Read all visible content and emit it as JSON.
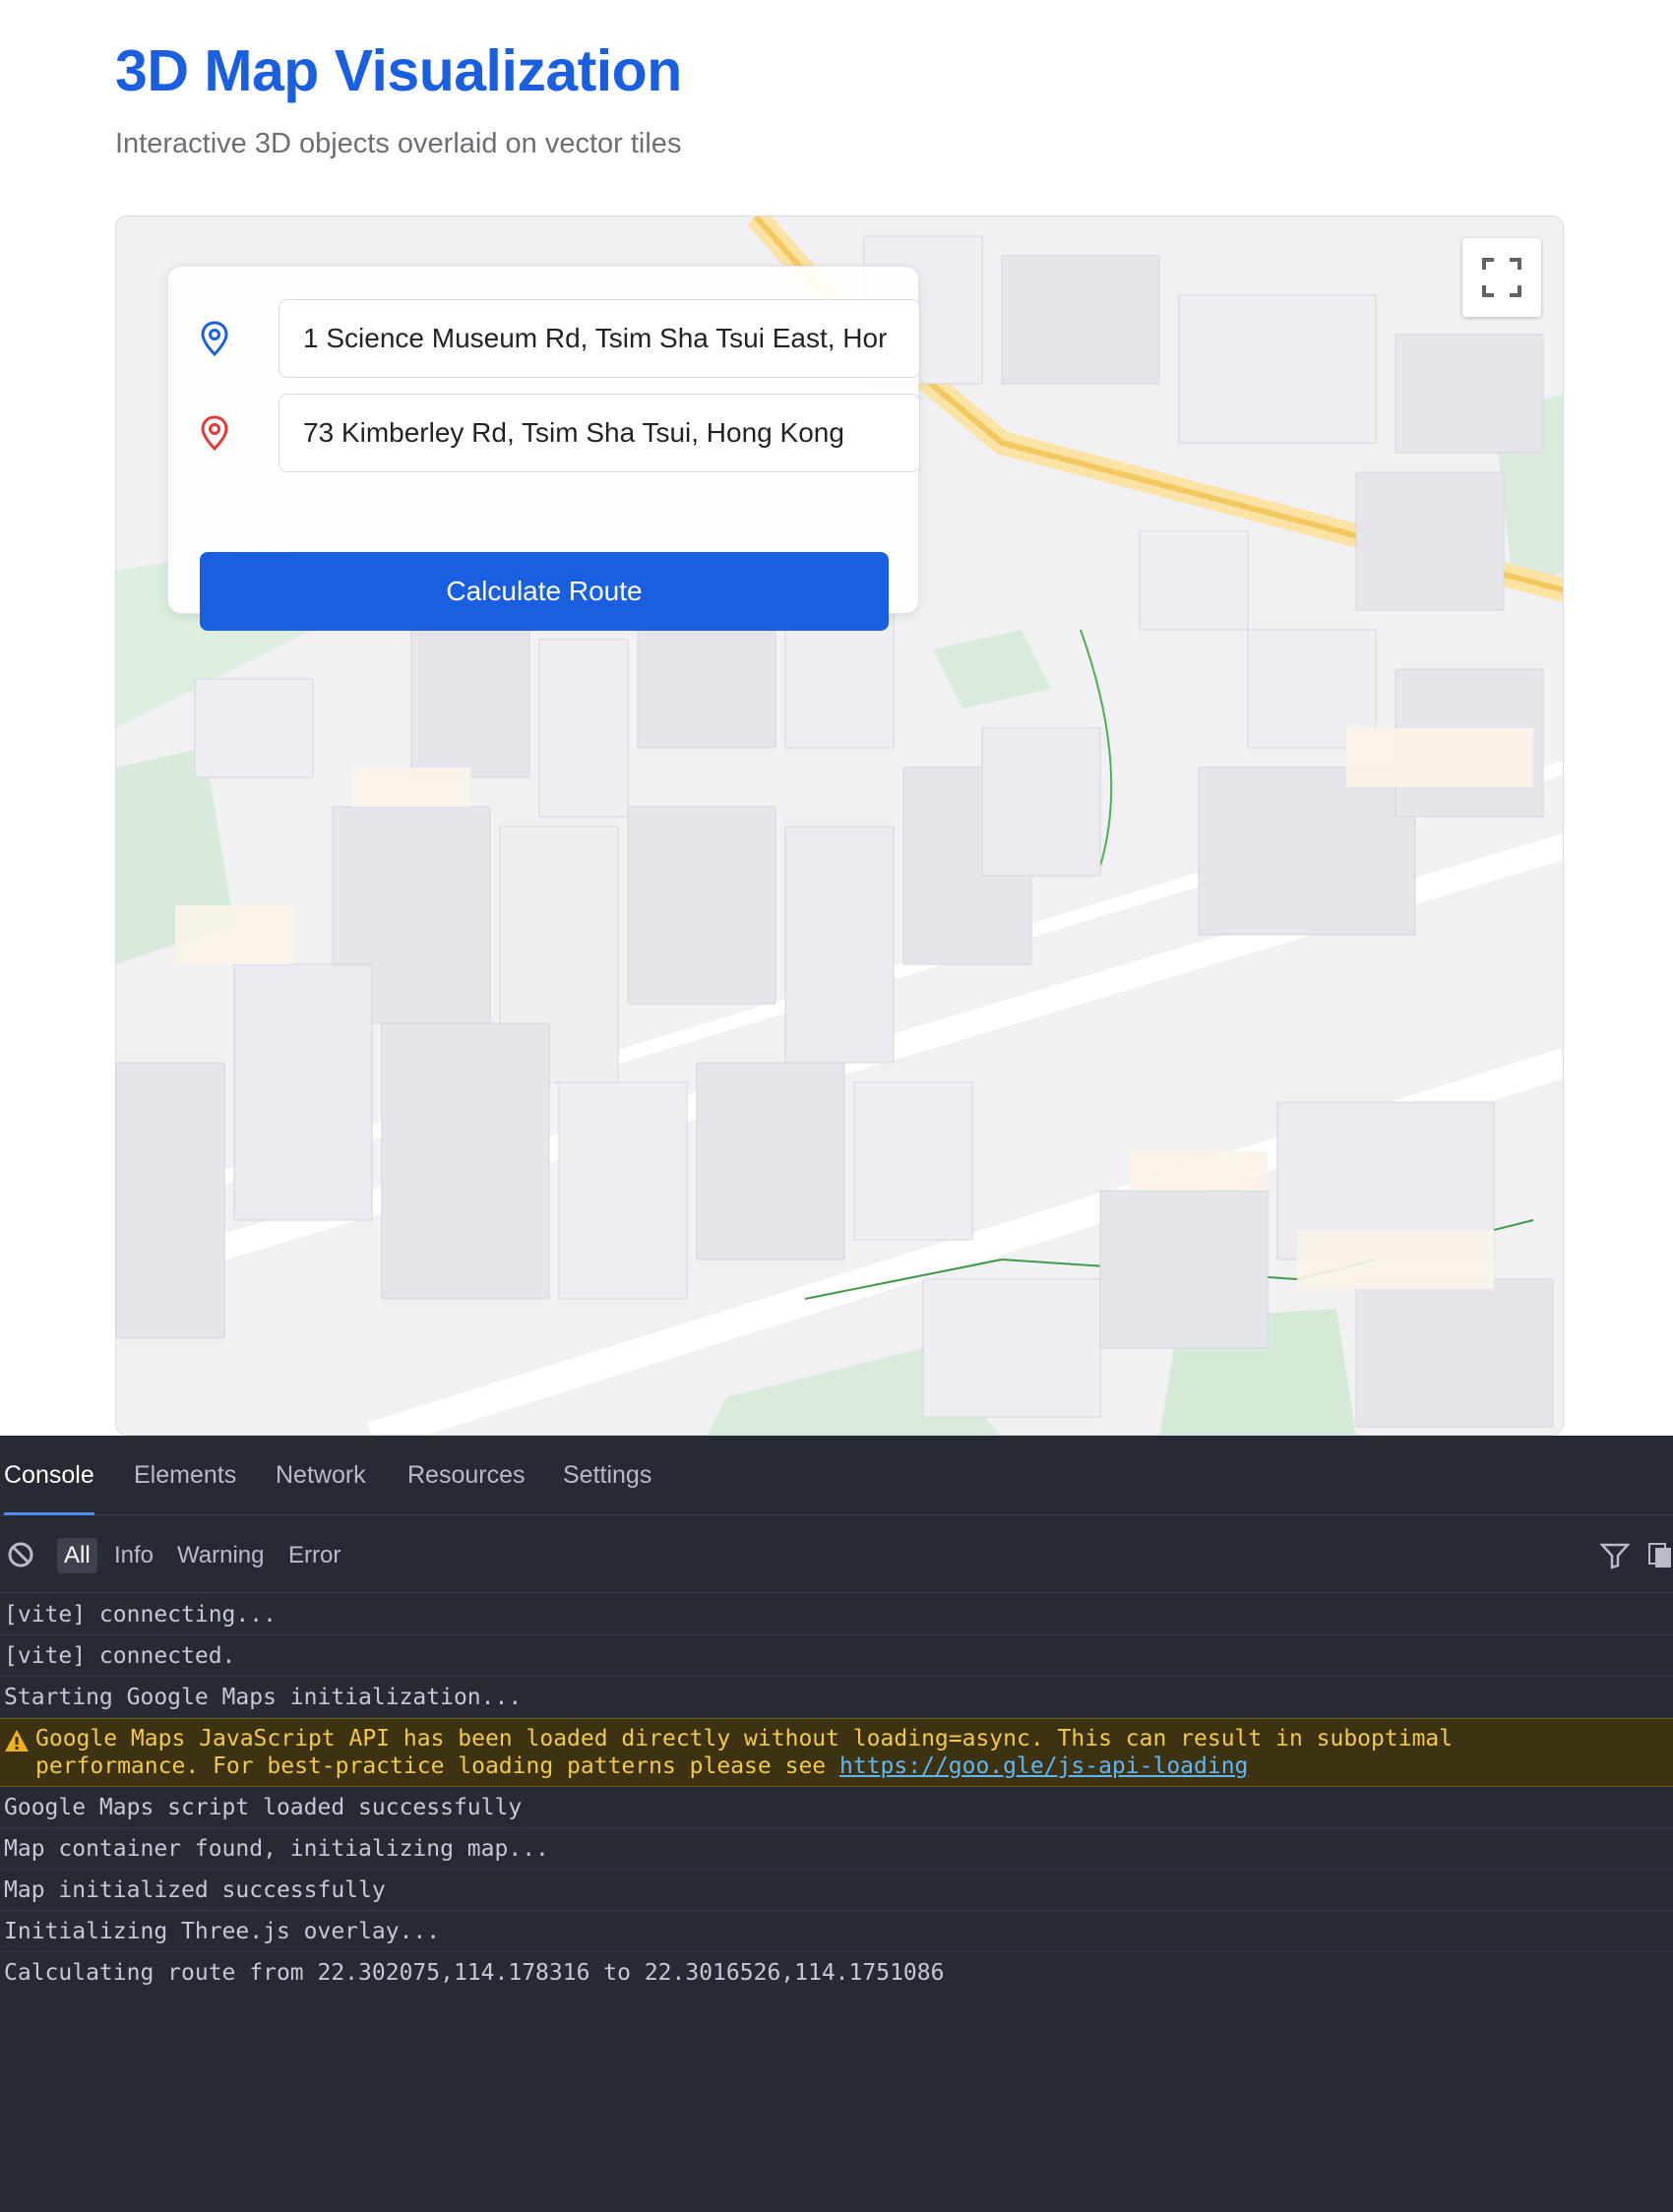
{
  "header": {
    "title": "3D Map Visualization",
    "subtitle": "Interactive 3D objects overlaid on vector tiles"
  },
  "route_panel": {
    "origin_value": "1 Science Museum Rd, Tsim Sha Tsui East, Hor",
    "destination_value": "73 Kimberley Rd, Tsim Sha Tsui, Hong Kong",
    "calculate_label": "Calculate Route"
  },
  "map": {
    "fullscreen_icon": "fullscreen-icon",
    "origin_pin_color": "#1a5fe0",
    "destination_pin_color": "#e53935"
  },
  "devtools": {
    "tabs": [
      "Console",
      "Elements",
      "Network",
      "Resources",
      "Settings"
    ],
    "active_tab": "Console",
    "levels": [
      "All",
      "Info",
      "Warning",
      "Error"
    ],
    "active_level": "All",
    "logs": [
      "[vite] connecting...",
      "[vite] connected.",
      "Starting Google Maps initialization..."
    ],
    "warning": {
      "line1": "Google Maps JavaScript API has been loaded directly without loading=async. This can result in suboptimal",
      "line2_prefix": "performance. For best-practice loading patterns please see ",
      "link": "https://goo.gle/js-api-loading"
    },
    "logs_after": [
      "Google Maps script loaded successfully",
      "Map container found, initializing map...",
      "Map initialized successfully",
      "Initializing Three.js overlay...",
      "Calculating route from 22.302075,114.178316 to 22.3016526,114.1751086"
    ]
  }
}
